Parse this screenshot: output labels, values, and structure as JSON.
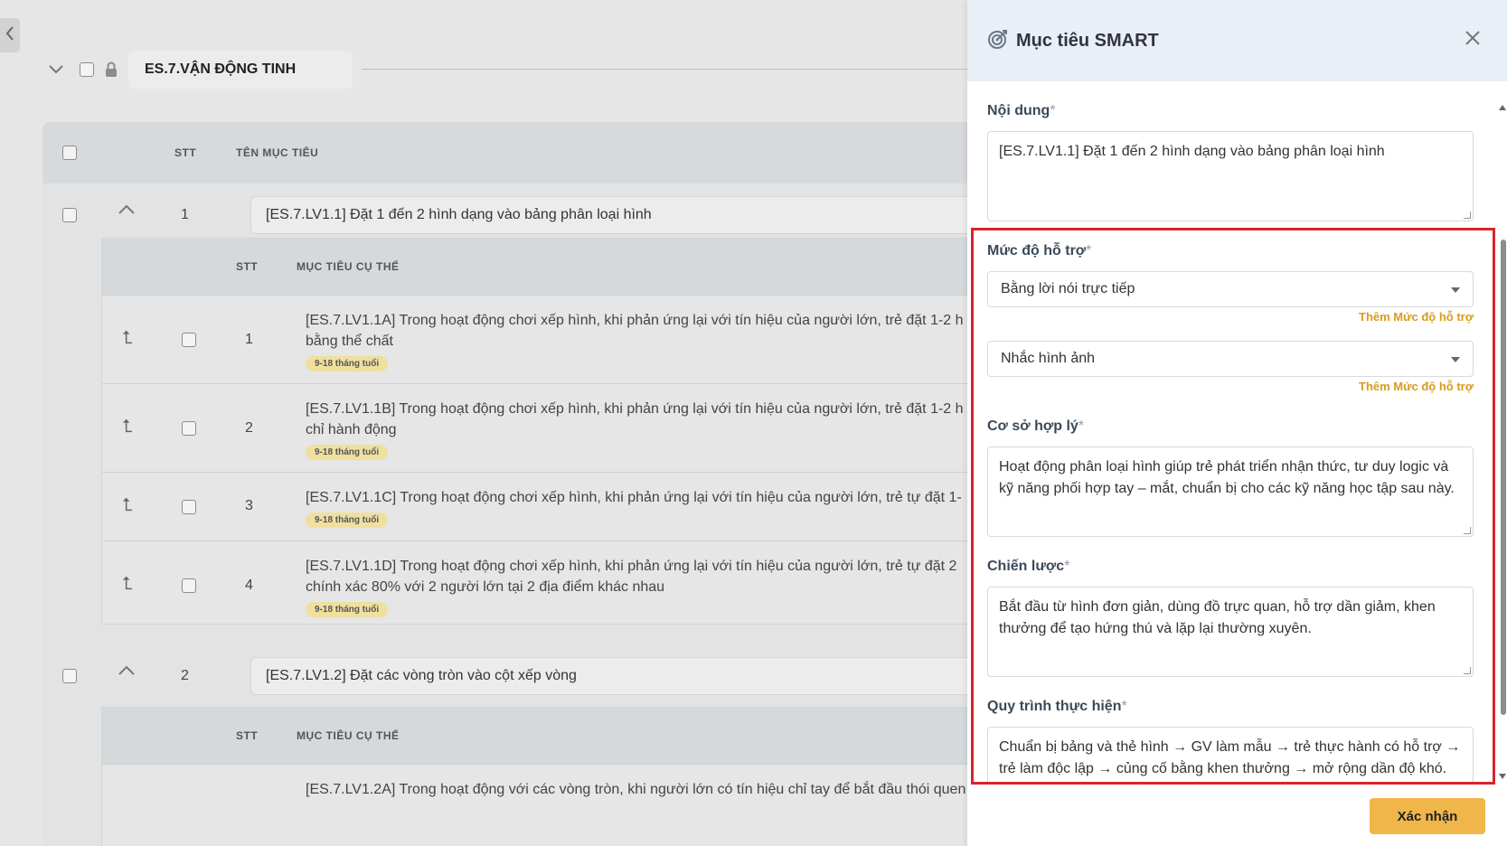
{
  "section": {
    "title": "ES.7.VẬN ĐỘNG TINH"
  },
  "table": {
    "col_stt": "STT",
    "col_name": "TÊN MỤC TIÊU",
    "goals": [
      {
        "num": "1",
        "text": "[ES.7.LV1.1] Đặt 1 đến 2 hình dạng vào bảng phân loại hình",
        "sub_col_stt": "STT",
        "sub_col_name": "MỤC TIÊU CỤ THỂ",
        "subs": [
          {
            "num": "1",
            "line1": "[ES.7.LV1.1A] Trong hoạt động chơi xếp hình, khi phản ứng lại với tín hiệu của người lớn, trẻ đặt 1-2 h",
            "line2": "bằng thể chất",
            "tag": "9-18 tháng tuổi"
          },
          {
            "num": "2",
            "line1": "[ES.7.LV1.1B] Trong hoạt động chơi xếp hình, khi phản ứng lại với tín hiệu của người lớn, trẻ đặt 1-2 h",
            "line2": "chỉ hành động",
            "tag": "9-18 tháng tuổi"
          },
          {
            "num": "3",
            "line1": "[ES.7.LV1.1C] Trong hoạt động chơi xếp hình, khi phản ứng lại với tín hiệu của người lớn, trẻ tự đặt 1-",
            "line2": "",
            "tag": "9-18 tháng tuổi"
          },
          {
            "num": "4",
            "line1": "[ES.7.LV1.1D] Trong hoạt động chơi xếp hình, khi phản ứng lại với tín hiệu của người lớn, trẻ tự đặt 2",
            "line2": "chính xác 80% với 2 người lớn tại 2 địa điểm khác nhau",
            "tag": "9-18 tháng tuổi"
          }
        ]
      },
      {
        "num": "2",
        "text": "[ES.7.LV1.2] Đặt các vòng tròn vào cột xếp vòng",
        "sub_col_stt": "STT",
        "sub_col_name": "MỤC TIÊU CỤ THỂ",
        "subs": [
          {
            "num": "",
            "line1": "[ES.7.LV1.2A] Trong hoạt động với các vòng tròn, khi người lớn có tín hiệu chỉ tay để bắt đầu thói quen",
            "line2": "",
            "tag": ""
          }
        ]
      }
    ]
  },
  "drawer": {
    "title": "Mục tiêu SMART",
    "content_label": "Nội dung",
    "content_value": "[ES.7.LV1.1] Đặt 1 đến 2 hình dạng vào bảng phân loại hình",
    "support_label": "Mức độ hỗ trợ",
    "support_1": "Bằng lời nói trực tiếp",
    "support_2": "Nhắc hình ảnh",
    "add_support": "Thêm Mức độ hỗ trợ",
    "rationale_label": "Cơ sở hợp lý",
    "rationale_value": "Hoạt động phân loại hình giúp trẻ phát triển nhận thức, tư duy logic và kỹ năng phối hợp tay – mắt, chuẩn bị cho các kỹ năng học tập sau này.",
    "strategy_label": "Chiến lược",
    "strategy_value": "Bắt đầu từ hình đơn giản, dùng đồ trực quan, hỗ trợ dần giảm, khen thưởng để tạo hứng thú và lặp lại thường xuyên.",
    "process_label": "Quy trình thực hiện",
    "process_value": "Chuẩn bị bảng và thẻ hình → GV làm mẫu → trẻ thực hành có hỗ trợ → trẻ làm độc lập → củng cố bằng khen thưởng → mở rộng dần độ khó.",
    "required_mark": "*",
    "confirm": "Xác nhận"
  },
  "colors": {
    "accent": "#f0b64a",
    "link": "#d99a1c",
    "highlight": "#d8232a",
    "header_bg": "#e9eff6"
  },
  "icons": [
    "chevron-left-icon",
    "chevron-down-icon",
    "lock-icon",
    "chevron-up-icon",
    "return-arrow-icon",
    "target-icon",
    "close-icon",
    "dropdown-caret-icon"
  ]
}
